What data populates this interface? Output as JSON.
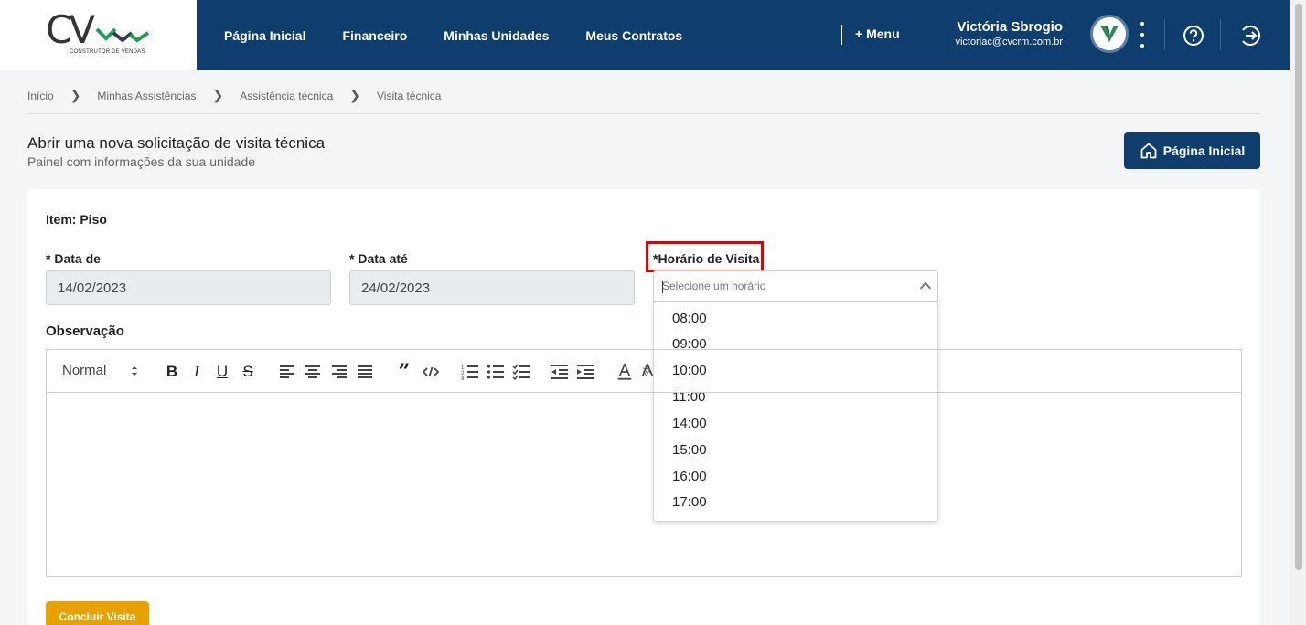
{
  "logo": {
    "text": "CV",
    "subtitle": "CONSTRUTOR DE VENDAS"
  },
  "nav": {
    "items": [
      {
        "label": "Página Inicial"
      },
      {
        "label": "Financeiro"
      },
      {
        "label": "Minhas Unidades"
      },
      {
        "label": "Meus Contratos"
      }
    ],
    "menu_label": "+ Menu"
  },
  "user": {
    "name": "Victória Sbrogio",
    "email": "victoriac@cvcrm.com.br",
    "avatar_icon": "cv-logo-icon"
  },
  "header_icons": [
    "kebab-menu-icon",
    "help-circle-icon",
    "logout-icon"
  ],
  "breadcrumb": [
    "Início",
    "Minhas Assistências",
    "Assistência técnica",
    "Visita técnica"
  ],
  "page": {
    "title": "Abrir uma nova solicitação de visita técnica",
    "subtitle": "Painel com informações da sua unidade",
    "home_button": "Página Inicial"
  },
  "form": {
    "item_label": "Item: Piso",
    "date_from_label": "* Data de",
    "date_from_value": "14/02/2023",
    "date_to_label": "* Data até",
    "date_to_value": "24/02/2023",
    "time_label": "*Horário de Visita",
    "time_placeholder": "Selecione um horário",
    "time_options": [
      "08:00",
      "09:00",
      "10:00",
      "11:00",
      "14:00",
      "15:00",
      "16:00",
      "17:00"
    ],
    "observation_label": "Observação",
    "editor_format": "Normal",
    "submit_label": "Concluir Visita"
  },
  "colors": {
    "header": "#0f3d6e",
    "accent_green": "#2e8b57",
    "submit": "#e8a200",
    "highlight": "#e30000"
  }
}
